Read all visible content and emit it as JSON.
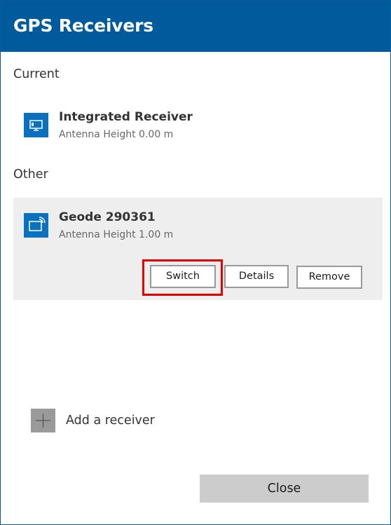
{
  "dialog": {
    "title": "GPS Receivers"
  },
  "current": {
    "section_label": "Current",
    "receiver": {
      "name": "Integrated Receiver",
      "subtitle": "Antenna Height 0.00 m",
      "icon": "integrated-receiver-icon"
    }
  },
  "other": {
    "section_label": "Other",
    "receiver": {
      "name": "Geode 290361",
      "subtitle": "Antenna Height 1.00 m",
      "icon": "bluetooth-receiver-icon"
    },
    "actions": {
      "switch_label": "Switch",
      "details_label": "Details",
      "remove_label": "Remove"
    }
  },
  "add_receiver": {
    "label": "Add a receiver",
    "icon": "plus-icon"
  },
  "footer": {
    "close_label": "Close"
  },
  "colors": {
    "title_bar": "#005a9c",
    "icon_tile": "#0a70c0",
    "card_bg": "#eeeeee",
    "highlight": "#e30000",
    "close_bg": "#cccccc"
  }
}
